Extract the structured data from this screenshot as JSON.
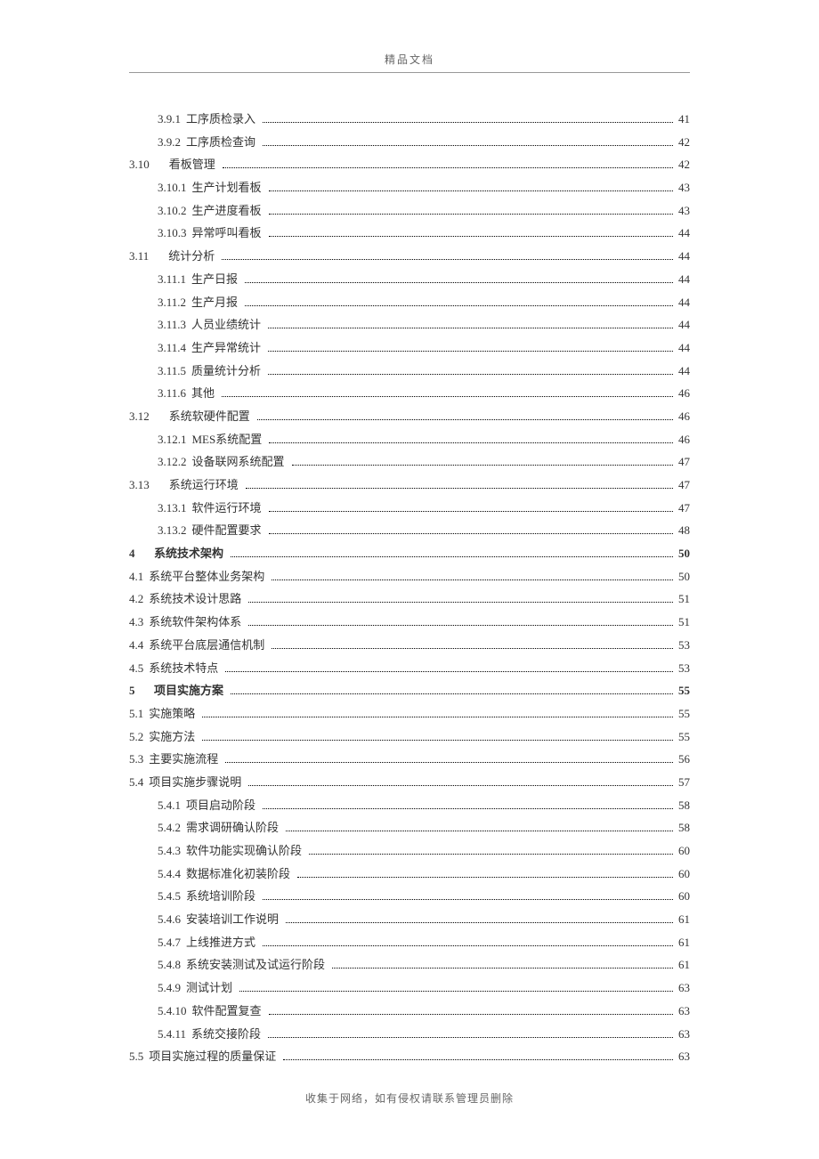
{
  "header": "精品文档",
  "footer": "收集于网络，如有侵权请联系管理员删除",
  "toc": [
    {
      "indent": 2,
      "num": "3.9.1",
      "label": "工序质检录入",
      "page": "41",
      "bold": false,
      "wide": false
    },
    {
      "indent": 2,
      "num": "3.9.2",
      "label": "工序质检查询",
      "page": "42",
      "bold": false,
      "wide": false
    },
    {
      "indent": 1,
      "num": "3.10",
      "label": "看板管理",
      "page": "42",
      "bold": false,
      "wide": true
    },
    {
      "indent": 2,
      "num": "3.10.1",
      "label": "生产计划看板",
      "page": "43",
      "bold": false,
      "wide": false
    },
    {
      "indent": 2,
      "num": "3.10.2",
      "label": "生产进度看板",
      "page": "43",
      "bold": false,
      "wide": false
    },
    {
      "indent": 2,
      "num": "3.10.3",
      "label": "异常呼叫看板",
      "page": "44",
      "bold": false,
      "wide": false
    },
    {
      "indent": 1,
      "num": "3.11",
      "label": "统计分析",
      "page": "44",
      "bold": false,
      "wide": true
    },
    {
      "indent": 2,
      "num": "3.11.1",
      "label": "生产日报",
      "page": "44",
      "bold": false,
      "wide": false
    },
    {
      "indent": 2,
      "num": "3.11.2",
      "label": "生产月报",
      "page": "44",
      "bold": false,
      "wide": false
    },
    {
      "indent": 2,
      "num": "3.11.3",
      "label": "人员业绩统计",
      "page": "44",
      "bold": false,
      "wide": false
    },
    {
      "indent": 2,
      "num": "3.11.4",
      "label": "生产异常统计",
      "page": "44",
      "bold": false,
      "wide": false
    },
    {
      "indent": 2,
      "num": "3.11.5",
      "label": "质量统计分析",
      "page": "44",
      "bold": false,
      "wide": false
    },
    {
      "indent": 2,
      "num": "3.11.6",
      "label": "其他",
      "page": "46",
      "bold": false,
      "wide": false
    },
    {
      "indent": 1,
      "num": "3.12",
      "label": "系统软硬件配置",
      "page": "46",
      "bold": false,
      "wide": true
    },
    {
      "indent": 2,
      "num": "3.12.1",
      "label": "MES系统配置",
      "page": "46",
      "bold": false,
      "wide": false
    },
    {
      "indent": 2,
      "num": "3.12.2",
      "label": "设备联网系统配置",
      "page": "47",
      "bold": false,
      "wide": false
    },
    {
      "indent": 1,
      "num": "3.13",
      "label": "系统运行环境",
      "page": "47",
      "bold": false,
      "wide": true
    },
    {
      "indent": 2,
      "num": "3.13.1",
      "label": "软件运行环境",
      "page": "47",
      "bold": false,
      "wide": false
    },
    {
      "indent": 2,
      "num": "3.13.2",
      "label": "硬件配置要求",
      "page": "48",
      "bold": false,
      "wide": false
    },
    {
      "indent": 0,
      "num": "4",
      "label": "系统技术架构",
      "page": "50",
      "bold": true,
      "wide": false
    },
    {
      "indent": 1,
      "num": "4.1",
      "label": "系统平台整体业务架构",
      "page": "50",
      "bold": false,
      "wide": false
    },
    {
      "indent": 1,
      "num": "4.2",
      "label": "系统技术设计思路",
      "page": "51",
      "bold": false,
      "wide": false
    },
    {
      "indent": 1,
      "num": "4.3",
      "label": "系统软件架构体系",
      "page": "51",
      "bold": false,
      "wide": false
    },
    {
      "indent": 1,
      "num": "4.4",
      "label": "系统平台底层通信机制",
      "page": "53",
      "bold": false,
      "wide": false
    },
    {
      "indent": 1,
      "num": "4.5",
      "label": "系统技术特点",
      "page": "53",
      "bold": false,
      "wide": false
    },
    {
      "indent": 0,
      "num": "5",
      "label": "项目实施方案",
      "page": "55",
      "bold": true,
      "wide": false
    },
    {
      "indent": 1,
      "num": "5.1",
      "label": "实施策略",
      "page": "55",
      "bold": false,
      "wide": false
    },
    {
      "indent": 1,
      "num": "5.2",
      "label": "实施方法",
      "page": "55",
      "bold": false,
      "wide": false
    },
    {
      "indent": 1,
      "num": "5.3",
      "label": "主要实施流程",
      "page": "56",
      "bold": false,
      "wide": false
    },
    {
      "indent": 1,
      "num": "5.4",
      "label": "项目实施步骤说明",
      "page": "57",
      "bold": false,
      "wide": false
    },
    {
      "indent": 2,
      "num": "5.4.1",
      "label": "项目启动阶段",
      "page": "58",
      "bold": false,
      "wide": false
    },
    {
      "indent": 2,
      "num": "5.4.2",
      "label": "需求调研确认阶段",
      "page": "58",
      "bold": false,
      "wide": false
    },
    {
      "indent": 2,
      "num": "5.4.3",
      "label": "软件功能实现确认阶段",
      "page": "60",
      "bold": false,
      "wide": false
    },
    {
      "indent": 2,
      "num": "5.4.4",
      "label": "数据标准化初装阶段",
      "page": "60",
      "bold": false,
      "wide": false
    },
    {
      "indent": 2,
      "num": "5.4.5",
      "label": "系统培训阶段",
      "page": "60",
      "bold": false,
      "wide": false
    },
    {
      "indent": 2,
      "num": "5.4.6",
      "label": "安装培训工作说明",
      "page": "61",
      "bold": false,
      "wide": false
    },
    {
      "indent": 2,
      "num": "5.4.7",
      "label": "上线推进方式",
      "page": "61",
      "bold": false,
      "wide": false
    },
    {
      "indent": 2,
      "num": "5.4.8",
      "label": "系统安装测试及试运行阶段",
      "page": "61",
      "bold": false,
      "wide": false
    },
    {
      "indent": 2,
      "num": "5.4.9",
      "label": "测试计划",
      "page": "63",
      "bold": false,
      "wide": false
    },
    {
      "indent": 2,
      "num": "5.4.10",
      "label": "软件配置复查",
      "page": "63",
      "bold": false,
      "wide": false
    },
    {
      "indent": 2,
      "num": "5.4.11",
      "label": "系统交接阶段",
      "page": "63",
      "bold": false,
      "wide": false
    },
    {
      "indent": 1,
      "num": "5.5",
      "label": "项目实施过程的质量保证",
      "page": "63",
      "bold": false,
      "wide": false
    }
  ]
}
